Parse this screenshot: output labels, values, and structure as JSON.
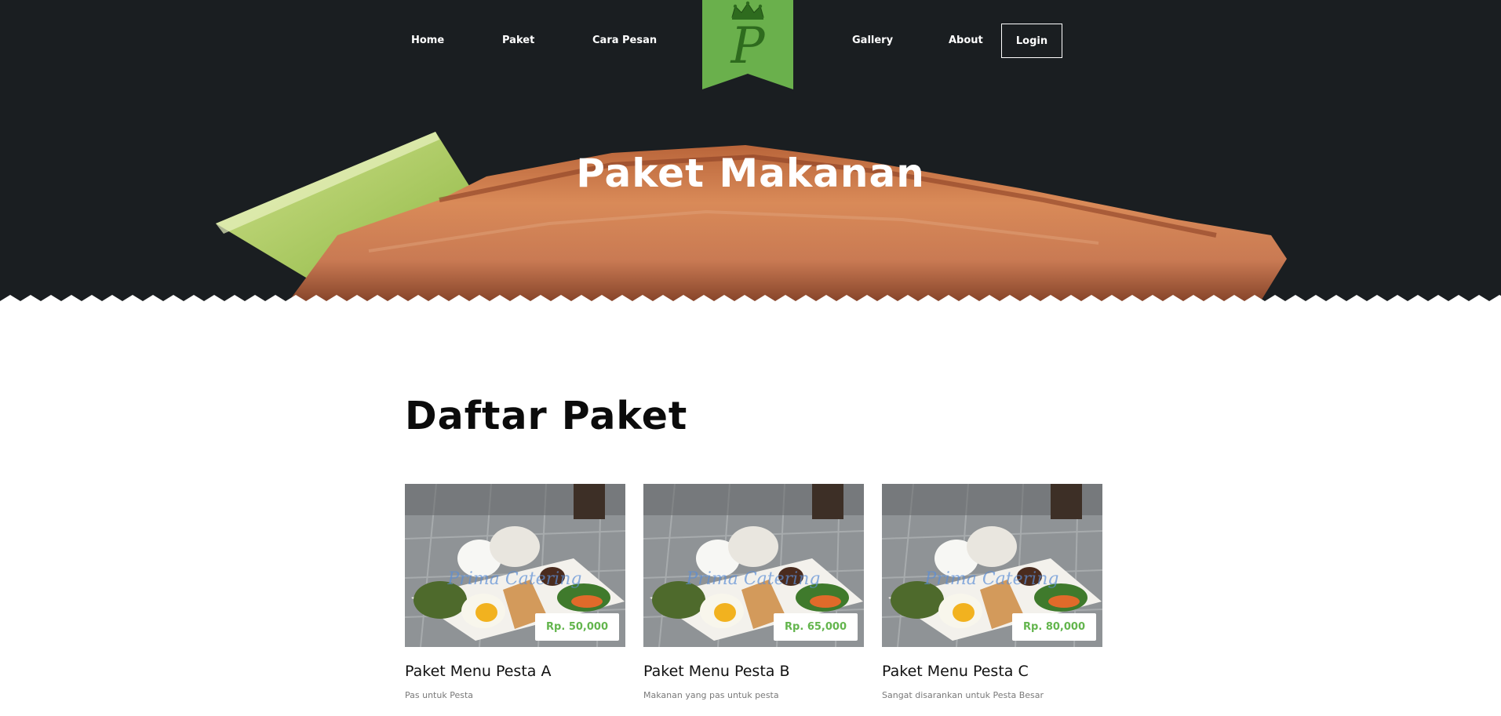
{
  "nav": {
    "left_items": [
      "Home",
      "Paket",
      "Cara Pesan"
    ],
    "right_items": [
      "Gallery",
      "About"
    ],
    "login_label": "Login"
  },
  "logo": {
    "letter": "P",
    "color": "#6ab04c"
  },
  "hero": {
    "title": "Paket Makanan"
  },
  "main": {
    "section_title": "Daftar Paket",
    "packages": [
      {
        "name": "Paket Menu Pesta A",
        "description": "Pas untuk Pesta",
        "price": "Rp. 50,000"
      },
      {
        "name": "Paket Menu Pesta B",
        "description": "Makanan yang pas untuk pesta",
        "price": "Rp. 65,000"
      },
      {
        "name": "Paket Menu Pesta C",
        "description": "Sangat disarankan untuk Pesta Besar",
        "price": "Rp. 80,000"
      }
    ],
    "image_watermark": "Prima Catering"
  },
  "colors": {
    "accent": "#63b54d",
    "hero_bg": "#161a1d"
  }
}
